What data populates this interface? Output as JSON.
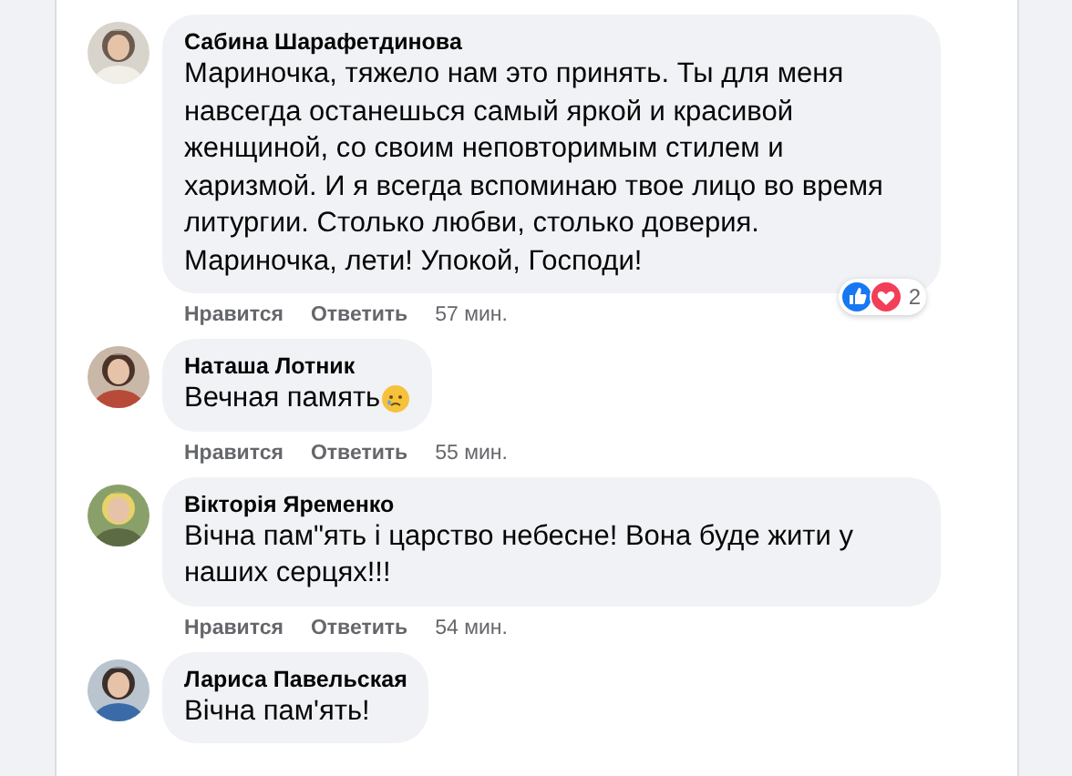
{
  "comments": [
    {
      "author": "Сабина Шарафетдинова",
      "text": "Мариночка, тяжело нам это принять. Ты для меня навсегда останешься самый яркой и красивой женщиной, со своим неповторимым стилем и харизмой. И я всегда вспоминаю твое лицо во время литургии. Столько любви, столько доверия. Мариночка, лети! Упокой, Господи!",
      "reactions": {
        "like": true,
        "love": true,
        "count": "2"
      },
      "actions": [
        "Нравится",
        "Ответить"
      ],
      "time": "57 мин."
    },
    {
      "author": "Наташа Лотник",
      "text": "Вечная память",
      "sad_emoji": true,
      "actions": [
        "Нравится",
        "Ответить"
      ],
      "time": "55 мин."
    },
    {
      "author": "Вікторія Яременко",
      "text": "Вічна пам\"ять і царство небесне! Вона буде жити у наших серцях!!!",
      "actions": [
        "Нравится",
        "Ответить"
      ],
      "time": "54 мин."
    },
    {
      "author": "Лариса Павельская",
      "text": "Вічна пам'ять!"
    }
  ]
}
